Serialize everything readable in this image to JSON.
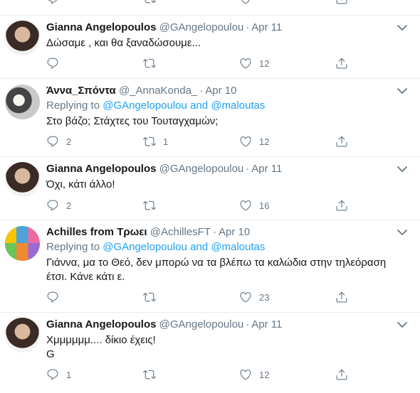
{
  "colors": {
    "accent": "#1da1f2",
    "secondary_text": "#657786",
    "divider": "#e6ecf0"
  },
  "tweets": [
    {
      "name": "Gianna Angelopoulos",
      "handle": "@GAngelopoulou",
      "date": "Apr 11",
      "text": "Δώσαμε , και θα ξαναδώσουμε...",
      "reply_count": "",
      "retweet_count": "",
      "like_count": "12"
    },
    {
      "name": "Άννα_Σπόντα",
      "handle": "@_AnnaKonda_",
      "date": "Apr 10",
      "replying_prefix": "Replying to",
      "replying_user1": "@GAngelopoulou",
      "replying_and": "and",
      "replying_user2": "@maloutas",
      "text": "Στο βάζο; Στάχτες του Τουταγχαμών;",
      "reply_count": "2",
      "retweet_count": "1",
      "like_count": "12"
    },
    {
      "name": "Gianna Angelopoulos",
      "handle": "@GAngelopoulou",
      "date": "Apr 11",
      "text": "Όχι, κάτι άλλο!",
      "reply_count": "2",
      "retweet_count": "",
      "like_count": "16"
    },
    {
      "name": "Achilles from Τρωει",
      "handle": "@AchillesFT",
      "date": "Apr 10",
      "replying_prefix": "Replying to",
      "replying_user1": "@GAngelopoulou",
      "replying_and": "and",
      "replying_user2": "@maloutas",
      "text_line1": "Γιάννα, μα το Θεό, δεν μπορώ να τα βλέπω τα καλώδια στην τηλεόραση",
      "text_line2": "έτσι. Κάνε κάτι ε.",
      "reply_count": "",
      "retweet_count": "",
      "like_count": "23"
    },
    {
      "name": "Gianna Angelopoulos",
      "handle": "@GAngelopoulou",
      "date": "Apr 11",
      "text_line1": "Χμμμμμμ.... δίκιο έχεις!",
      "text_line2": "G",
      "reply_count": "1",
      "retweet_count": "",
      "like_count": "12"
    }
  ],
  "icons": {
    "reply": "reply-icon",
    "retweet": "retweet-icon",
    "like": "heart-icon",
    "share": "share-icon",
    "more": "chevron-down-icon"
  }
}
